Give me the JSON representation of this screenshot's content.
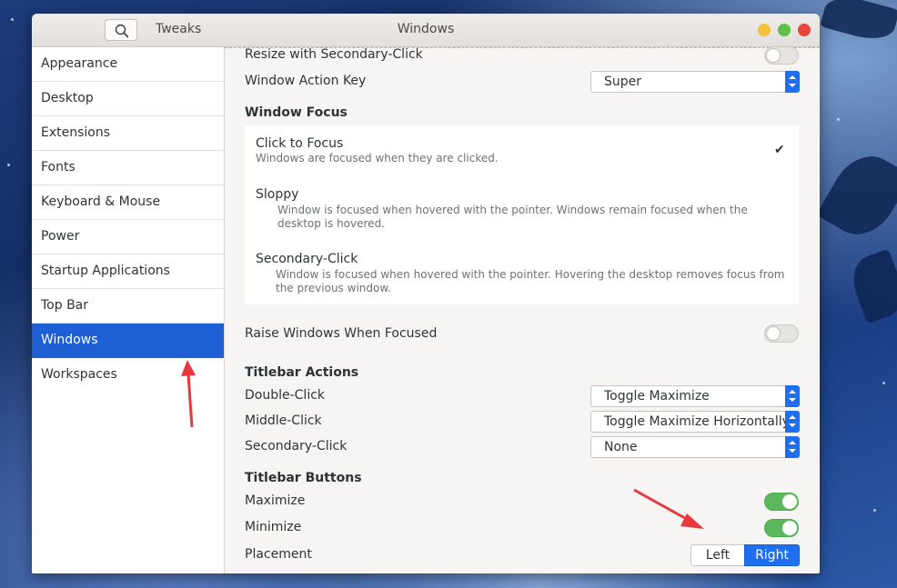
{
  "titlebar": {
    "app_name": "Tweaks",
    "panel_title": "Windows"
  },
  "sidebar": {
    "items": [
      {
        "label": "Appearance"
      },
      {
        "label": "Desktop"
      },
      {
        "label": "Extensions"
      },
      {
        "label": "Fonts"
      },
      {
        "label": "Keyboard & Mouse"
      },
      {
        "label": "Power"
      },
      {
        "label": "Startup Applications"
      },
      {
        "label": "Top Bar"
      },
      {
        "label": "Windows"
      },
      {
        "label": "Workspaces"
      }
    ],
    "selected": "Windows"
  },
  "settings": {
    "resize_secondary": {
      "label": "Resize with Secondary-Click",
      "enabled": false
    },
    "action_key": {
      "label": "Window Action Key",
      "value": "Super"
    },
    "window_focus": {
      "heading": "Window Focus",
      "options": [
        {
          "title": "Click to Focus",
          "desc": "Windows are focused when they are clicked.",
          "selected": true
        },
        {
          "title": "Sloppy",
          "desc": "Window is focused when hovered with the pointer. Windows remain focused when the desktop is hovered.",
          "selected": false
        },
        {
          "title": "Secondary-Click",
          "desc": "Window is focused when hovered with the pointer. Hovering the desktop removes focus from the previous window.",
          "selected": false
        }
      ],
      "check_glyph": "✔"
    },
    "raise_focused": {
      "label": "Raise Windows When Focused",
      "enabled": false
    },
    "titlebar_actions": {
      "heading": "Titlebar Actions",
      "double_click": {
        "label": "Double-Click",
        "value": "Toggle Maximize"
      },
      "middle_click": {
        "label": "Middle-Click",
        "value": "Toggle Maximize Horizontally"
      },
      "secondary_click": {
        "label": "Secondary-Click",
        "value": "None"
      }
    },
    "titlebar_buttons": {
      "heading": "Titlebar Buttons",
      "maximize": {
        "label": "Maximize",
        "enabled": true
      },
      "minimize": {
        "label": "Minimize",
        "enabled": true
      },
      "placement": {
        "label": "Placement",
        "options": [
          "Left",
          "Right"
        ],
        "selected": "Right"
      }
    }
  },
  "colors": {
    "accent": "#1e6ff0",
    "sidebar_selected": "#1e5fd6",
    "toggle_on": "#5cb85c",
    "annotation_arrow": "#e8383d"
  },
  "icons": {
    "search": "search-icon",
    "check": "check-icon"
  }
}
